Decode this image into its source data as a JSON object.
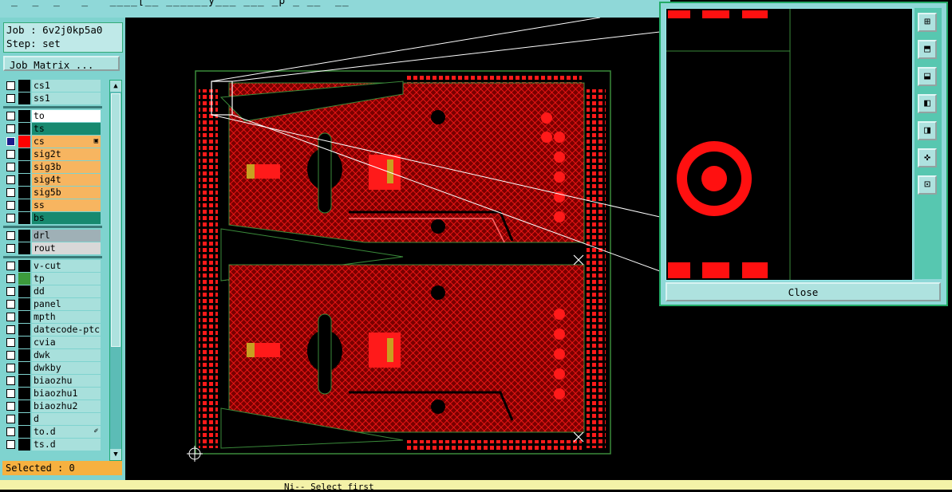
{
  "window": {
    "title": "_  _  _   _   ____[__ ______y___ ___ _p _ __  __"
  },
  "job": {
    "line": "Job : 6v2j0kp5a0",
    "step": "Step: set"
  },
  "job_matrix_button": "Job Matrix ...",
  "layers": [
    {
      "name": "cs1",
      "color": "#a8e0dc",
      "swatch": "#000000",
      "active": false
    },
    {
      "name": "ss1",
      "color": "#a8e0dc",
      "swatch": "#000000",
      "active": false
    },
    {
      "name": "to",
      "color": "#ffffff",
      "swatch": "#000000",
      "active": false
    },
    {
      "name": "ts",
      "color": "#17896f",
      "swatch": "#000000",
      "active": false
    },
    {
      "name": "cs",
      "color": "#f7b560",
      "swatch": "#ff0000",
      "active": true,
      "marker": "▣"
    },
    {
      "name": "sig2t",
      "color": "#f7b560",
      "swatch": "#000000",
      "active": false
    },
    {
      "name": "sig3b",
      "color": "#f7b560",
      "swatch": "#000000",
      "active": false
    },
    {
      "name": "sig4t",
      "color": "#f7b560",
      "swatch": "#000000",
      "active": false
    },
    {
      "name": "sig5b",
      "color": "#f7b560",
      "swatch": "#000000",
      "active": false
    },
    {
      "name": "ss",
      "color": "#f7b560",
      "swatch": "#000000",
      "active": false
    },
    {
      "name": "bs",
      "color": "#17896f",
      "swatch": "#000000",
      "active": false
    },
    {
      "name": "drl",
      "color": "#9fb0b6",
      "swatch": "#000000",
      "active": false
    },
    {
      "name": "rout",
      "color": "#d8d8d8",
      "swatch": "#000000",
      "active": false
    },
    {
      "name": "v-cut",
      "color": "#a8e0dc",
      "swatch": "#000000",
      "active": false
    },
    {
      "name": "tp",
      "color": "#a8e0dc",
      "swatch": "#3c9a3c",
      "active": false
    },
    {
      "name": "dd",
      "color": "#a8e0dc",
      "swatch": "#000000",
      "active": false
    },
    {
      "name": "panel",
      "color": "#a8e0dc",
      "swatch": "#000000",
      "active": false
    },
    {
      "name": "mpth",
      "color": "#a8e0dc",
      "swatch": "#000000",
      "active": false
    },
    {
      "name": "datecode-ptc",
      "color": "#a8e0dc",
      "swatch": "#000000",
      "active": false
    },
    {
      "name": "cvia",
      "color": "#a8e0dc",
      "swatch": "#000000",
      "active": false
    },
    {
      "name": "dwk",
      "color": "#a8e0dc",
      "swatch": "#000000",
      "active": false
    },
    {
      "name": "dwkby",
      "color": "#a8e0dc",
      "swatch": "#000000",
      "active": false
    },
    {
      "name": "biaozhu",
      "color": "#a8e0dc",
      "swatch": "#000000",
      "active": false
    },
    {
      "name": "biaozhu1",
      "color": "#a8e0dc",
      "swatch": "#000000",
      "active": false
    },
    {
      "name": "biaozhu2",
      "color": "#a8e0dc",
      "swatch": "#000000",
      "active": false
    },
    {
      "name": "d",
      "color": "#a8e0dc",
      "swatch": "#000000",
      "active": false
    },
    {
      "name": "to.d",
      "color": "#a8e0dc",
      "swatch": "#000000",
      "active": false,
      "marker": "✐"
    },
    {
      "name": "ts.d",
      "color": "#a8e0dc",
      "swatch": "#000000",
      "active": false
    }
  ],
  "selected_text": "Selected : 0",
  "status_bar": "Ni-- Select first",
  "zoom_window": {
    "close_label": "Close"
  },
  "tool_icons": [
    "zoom-in-icon",
    "pan-up-icon",
    "pan-down-icon",
    "pan-left-icon",
    "pan-right-icon",
    "fit-icon",
    "fit-all-icon"
  ],
  "colors": {
    "copper": "#ff1010",
    "outline": "#3a8a3a",
    "panel_bg": "#7fd3cf",
    "selected_bg": "#f6b140"
  }
}
